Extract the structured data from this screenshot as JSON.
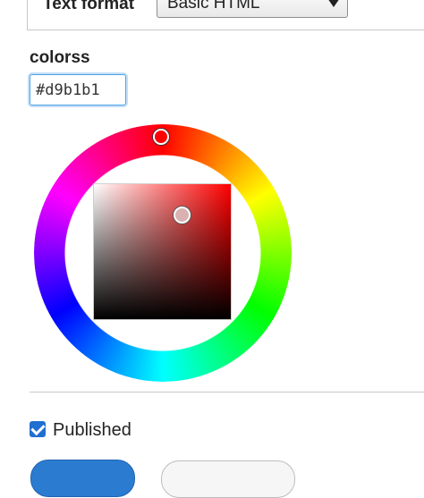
{
  "text_format": {
    "label": "Text format",
    "selected": "Basic HTML"
  },
  "color_field": {
    "label": "colorss",
    "value": "#d9b1b1"
  },
  "color_picker": {
    "hue_color": "#ff0000",
    "selected_color": "#d9b1b1"
  },
  "published": {
    "label": "Published",
    "checked": true
  },
  "colors": {
    "accent": "#2b7bd1",
    "focus": "#4ea5e6"
  }
}
